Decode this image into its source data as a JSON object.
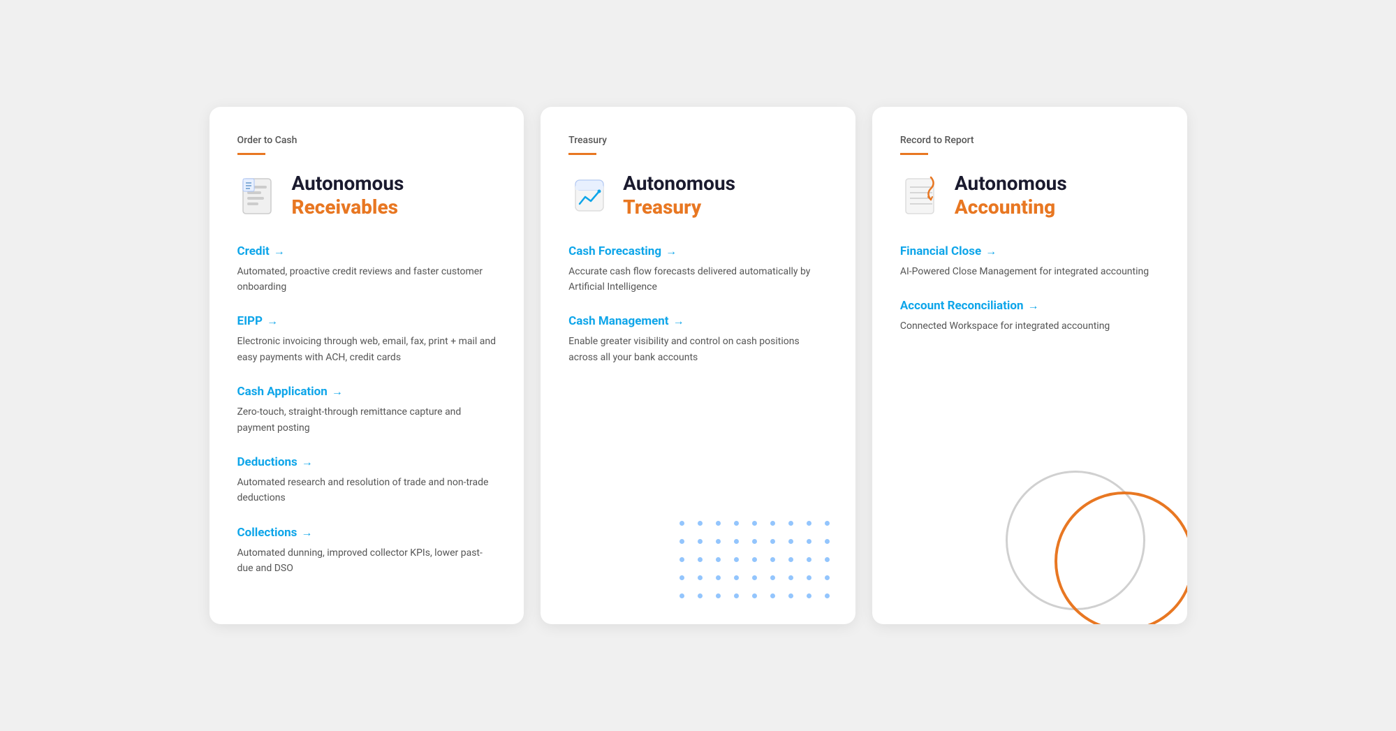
{
  "cards": [
    {
      "id": "receivables",
      "category": "Order to Cash",
      "title_top": "Autonomous",
      "title_bottom": "Receivables",
      "features": [
        {
          "id": "credit",
          "label": "Credit",
          "description": "Automated, proactive credit reviews and faster customer onboarding"
        },
        {
          "id": "eipp",
          "label": "EIPP",
          "description": "Electronic invoicing through web, email, fax, print + mail and easy payments with ACH, credit cards"
        },
        {
          "id": "cash-application",
          "label": "Cash Application",
          "description": "Zero-touch, straight-through remittance capture and payment posting"
        },
        {
          "id": "deductions",
          "label": "Deductions",
          "description": "Automated research and resolution of trade and non-trade deductions"
        },
        {
          "id": "collections",
          "label": "Collections",
          "description": "Automated dunning, improved collector KPIs, lower past-due and DSO"
        }
      ]
    },
    {
      "id": "treasury",
      "category": "Treasury",
      "title_top": "Autonomous",
      "title_bottom": "Treasury",
      "features": [
        {
          "id": "cash-forecasting",
          "label": "Cash Forecasting",
          "description": "Accurate cash flow forecasts delivered automatically by Artificial Intelligence"
        },
        {
          "id": "cash-management",
          "label": "Cash Management",
          "description": "Enable greater visibility and control on cash positions across all your bank accounts"
        }
      ]
    },
    {
      "id": "accounting",
      "category": "Record to Report",
      "title_top": "Autonomous",
      "title_bottom": "Accounting",
      "features": [
        {
          "id": "financial-close",
          "label": "Financial Close",
          "description": "AI-Powered Close Management for integrated accounting"
        },
        {
          "id": "account-reconciliation",
          "label": "Account Reconciliation",
          "description": "Connected Workspace for integrated accounting"
        }
      ]
    }
  ],
  "icons": {
    "receivables": "📋",
    "treasury": "📈",
    "accounting": "🔄"
  }
}
